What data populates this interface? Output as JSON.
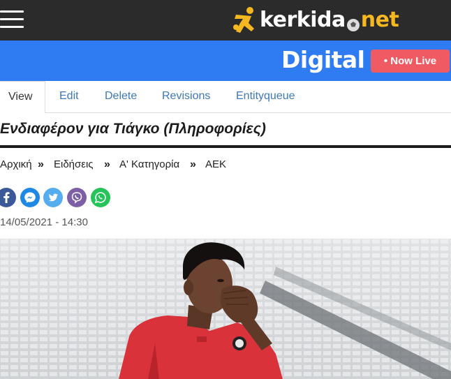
{
  "header": {
    "menu_icon": "hamburger-icon",
    "logo": {
      "word_white": "kerkida",
      "word_yellow": "net",
      "ball_icon": "football-icon",
      "runner_icon": "running-player-icon"
    }
  },
  "digital_bar": {
    "digital_label": "Digital",
    "live_button_label": "• Now Live",
    "colors": {
      "bar": "#2f7bf2",
      "live_button": "#ef5a63"
    }
  },
  "tabs": [
    {
      "label": "View",
      "active": true
    },
    {
      "label": "Edit",
      "active": false
    },
    {
      "label": "Delete",
      "active": false
    },
    {
      "label": "Revisions",
      "active": false
    },
    {
      "label": "Entityqueue",
      "active": false
    }
  ],
  "article": {
    "title": "Ενδιαφέρον για Τιάγκο (Πληροφορίες)",
    "breadcrumb": [
      "Αρχική",
      "Ειδήσεις",
      "Α' Κατηγορία",
      "ΑΕΚ"
    ],
    "breadcrumb_separator": "»",
    "date": "14/05/2021 - 14:30"
  },
  "share_buttons": [
    {
      "icon": "facebook-icon",
      "color": "#3b5998"
    },
    {
      "icon": "messenger-icon",
      "color": "#1e88e5"
    },
    {
      "icon": "twitter-icon",
      "color": "#55acee"
    },
    {
      "icon": "viber-icon",
      "color": "#7d5fa8"
    },
    {
      "icon": "whatsapp-icon",
      "color": "#25c45a"
    }
  ]
}
